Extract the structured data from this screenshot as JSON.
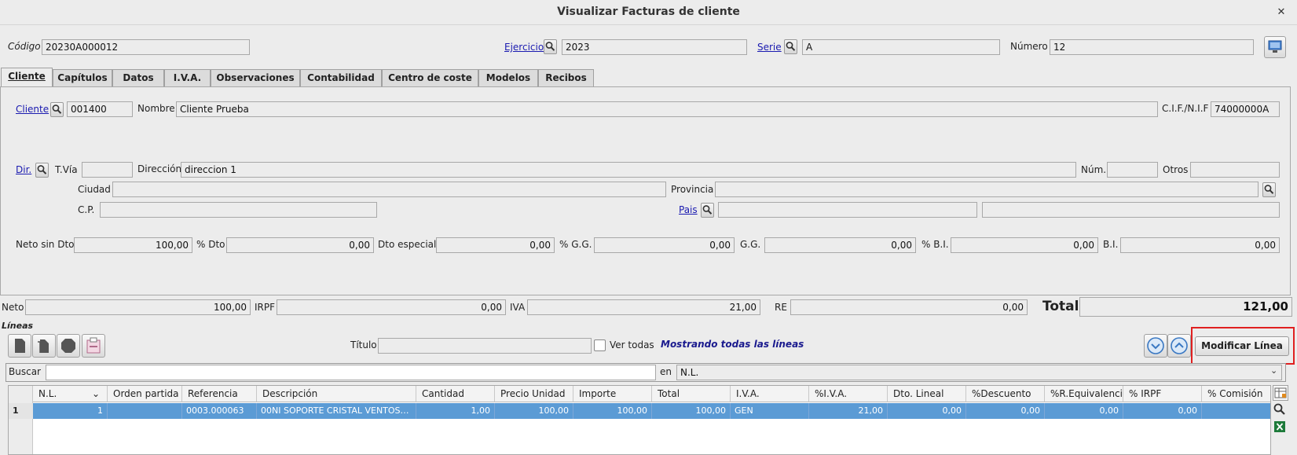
{
  "window": {
    "title": "Visualizar Facturas de cliente",
    "close_symbol": "✕"
  },
  "header": {
    "codigo_label": "Código",
    "codigo_value": "20230A000012",
    "ejercicio_label": "Ejercicio",
    "ejercicio_value": "2023",
    "serie_label": "Serie",
    "serie_value": "A",
    "numero_label": "Número",
    "numero_value": "12"
  },
  "tabs": [
    {
      "label": "Cliente",
      "active": true
    },
    {
      "label": "Capítulos"
    },
    {
      "label": "Datos"
    },
    {
      "label": "I.V.A."
    },
    {
      "label": "Observaciones"
    },
    {
      "label": "Contabilidad"
    },
    {
      "label": "Centro de coste"
    },
    {
      "label": "Modelos"
    },
    {
      "label": "Recibos"
    }
  ],
  "cliente": {
    "cliente_label": "Cliente",
    "cliente_value": "001400",
    "nombre_label": "Nombre",
    "nombre_value": "Cliente Prueba",
    "cif_label": "C.I.F./N.I.F",
    "cif_value": "74000000A",
    "dir_label": "Dir.",
    "tvia_label": "T.Vía",
    "tvia_value": "",
    "direccion_label": "Dirección",
    "direccion_value": "direccion 1",
    "num_label": "Núm.",
    "num_value": "",
    "otros_label": "Otros",
    "otros_value": "",
    "ciudad_label": "Ciudad",
    "ciudad_value": "",
    "provincia_label": "Provincia",
    "provincia_value": "",
    "cp_label": "C.P.",
    "cp_value": "",
    "pais_label": "Pais",
    "pais_value": "",
    "pais_name": ""
  },
  "importes": {
    "neto_sin_dto_label": "Neto sin Dto",
    "neto_sin_dto": "100,00",
    "pct_dto_label": "% Dto",
    "pct_dto": "0,00",
    "dto_especial_label": "Dto especial",
    "dto_especial": "0,00",
    "pct_gg_label": "% G.G.",
    "pct_gg": "0,00",
    "gg_label": "G.G.",
    "gg": "0,00",
    "pct_bi_label": "% B.I.",
    "pct_bi": "0,00",
    "bi_label": "B.I.",
    "bi": "0,00"
  },
  "totales": {
    "neto_label": "Neto",
    "neto": "100,00",
    "irpf_label": "IRPF",
    "irpf": "0,00",
    "iva_label": "IVA",
    "iva": "21,00",
    "re_label": "RE",
    "re": "0,00",
    "total_label": "Total",
    "total": "121,00"
  },
  "lineas": {
    "section_label": "Líneas",
    "titulo_label": "Título",
    "titulo_value": "",
    "ver_todas_label": "Ver todas",
    "status_text": "Mostrando todas las líneas",
    "modificar_label": "Modificar Línea",
    "buscar_label": "Buscar",
    "buscar_value": "",
    "en_label": "en",
    "en_value": "N.L."
  },
  "table": {
    "columns": [
      "N.L.",
      "Orden partida",
      "Referencia",
      "Descripción",
      "Cantidad",
      "Precio Unidad",
      "Importe",
      "Total",
      "I.V.A.",
      "%I.V.A.",
      "Dto. Lineal",
      "%Descuento",
      "%R.Equivalencia",
      "% IRPF",
      "% Comisión"
    ],
    "row_index": "1",
    "row": [
      "1",
      "",
      "0003.000063",
      "00NI SOPORTE CRISTAL VENTOS…",
      "1,00",
      "100,00",
      "100,00",
      "100,00",
      "GEN",
      "21,00",
      "0,00",
      "0,00",
      "0,00",
      "0,00",
      ""
    ]
  },
  "colors": {
    "selection": "#5b9bd5",
    "highlight": "#e02020",
    "link": "#1a1ab0"
  }
}
